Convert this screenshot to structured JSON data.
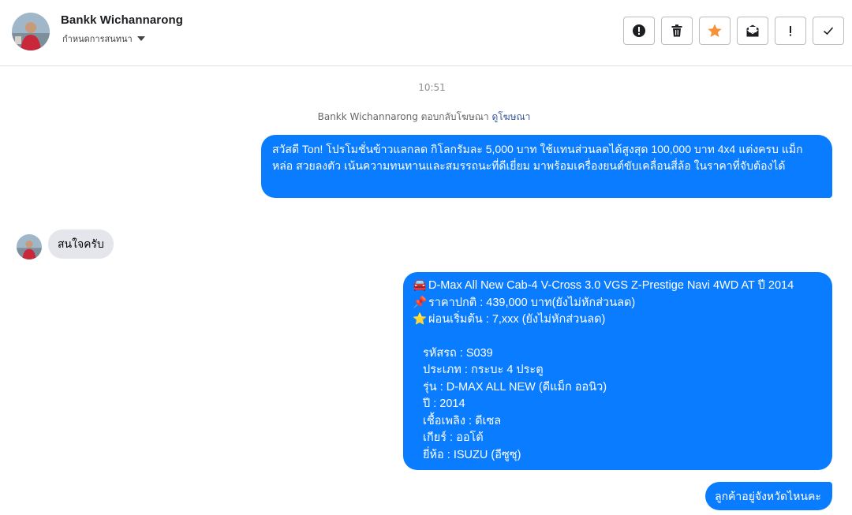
{
  "header": {
    "name": "Bankk Wichannarong",
    "subtitle": "กำหนดการสนทนา",
    "actions": [
      {
        "icon": "alert-circle-icon",
        "label": "Spam"
      },
      {
        "icon": "trash-icon",
        "label": "Delete"
      },
      {
        "icon": "star-icon",
        "label": "Star"
      },
      {
        "icon": "mark-unread-icon",
        "label": "Mark unread"
      },
      {
        "icon": "exclamation-icon",
        "label": "Follow up"
      },
      {
        "icon": "check-icon",
        "label": "Done"
      }
    ]
  },
  "conversation": {
    "timestamp": "10:51",
    "reply_note": "Bankk Wichannarong ตอบกลับโฆษณา",
    "reply_note_link": "ดูโฆษณา",
    "messages": [
      {
        "direction": "outgoing",
        "text": "สวัสดี Ton! โปรโมชั่นข้าวแลกลด กิโลกรัมละ 5,000 บาท ใช้แทนส่วนลดได้สูงสุด 100,000 บาท 4x4 แต่งครบ แม็กหล่อ สวยลงตัว เน้นความทนทานและสมรรถนะที่ดีเยี่ยม มาพร้อมเครื่องยนต์ขับเคลื่อนสี่ล้อ ในราคาที่จับต้องได้"
      },
      {
        "direction": "incoming",
        "text": "สนใจครับ"
      },
      {
        "direction": "outgoing",
        "lines": {
          "title": "D-Max All New Cab-4 V-Cross 3.0 VGS Z-Prestige Navi 4WD AT ปี 2014",
          "price": "ราคาปกติ : 439,000 บาท(ยังไม่หักส่วนลด)",
          "installment": "ผ่อนเริ่มต้น : 7,xxx (ยังไม่หักส่วนลด)",
          "code": "รหัสรถ : S039",
          "type": "ประเภท : กระบะ 4 ประตู",
          "model": "รุ่น : D-MAX ALL NEW (ดีแม็ก ออนิว)",
          "year": "ปี : 2014",
          "fuel": "เชื้อเพลิง : ดีเซล",
          "gear": "เกียร์ : ออโต้",
          "brand": "ยี่ห้อ : ISUZU (อีซูซุ)"
        }
      },
      {
        "direction": "outgoing",
        "text": "ลูกค้าอยู่จังหวัดไหนคะ"
      }
    ]
  },
  "colors": {
    "outgoing_bubble": "#0a7cff",
    "incoming_bubble": "#e4e6eb",
    "star": "#f7923a"
  }
}
